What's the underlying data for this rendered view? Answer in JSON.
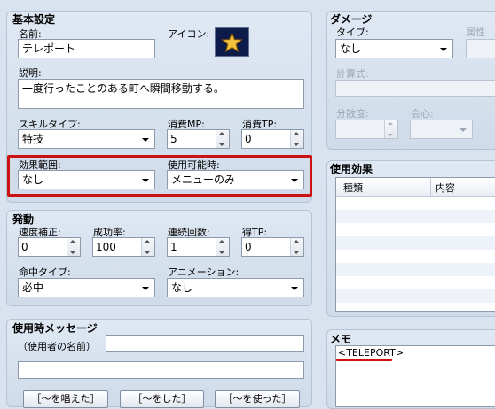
{
  "basic": {
    "title": "基本設定",
    "name_label": "名前:",
    "name_value": "テレポート",
    "icon_label": "アイコン:",
    "icon_name": "star-icon",
    "desc_label": "説明:",
    "desc_value": "一度行ったことのある町へ瞬間移動する。",
    "skilltype_label": "スキルタイプ:",
    "skilltype_value": "特技",
    "mp_label": "消費MP:",
    "mp_value": "5",
    "tp_label": "消費TP:",
    "tp_value": "0",
    "scope_label": "効果範囲:",
    "scope_value": "なし",
    "occasion_label": "使用可能時:",
    "occasion_value": "メニューのみ"
  },
  "invocation": {
    "title": "発動",
    "speed_label": "速度補正:",
    "speed_value": "0",
    "success_label": "成功率:",
    "success_value": "100",
    "repeat_label": "連続回数:",
    "repeat_value": "1",
    "tpgain_label": "得TP:",
    "tpgain_value": "0",
    "hittype_label": "命中タイプ:",
    "hittype_value": "必中",
    "animation_label": "アニメーション:",
    "animation_value": "なし"
  },
  "message": {
    "title": "使用時メッセージ",
    "user_name_label": "（使用者の名前）",
    "line1_value": "",
    "line2_value": "",
    "btn_cast": "［～を唱えた］",
    "btn_do": "［～をした］",
    "btn_use": "［～を使った］"
  },
  "damage": {
    "title": "ダメージ",
    "type_label": "タイプ:",
    "type_value": "なし",
    "element_label": "属性",
    "formula_label": "計算式:",
    "variance_label": "分散度:",
    "critical_label": "会心:"
  },
  "effects": {
    "title": "使用効果",
    "col_type": "種類",
    "col_content": "内容"
  },
  "memo": {
    "title": "メモ",
    "value": "<TELEPORT>"
  },
  "colors": {
    "highlight_red": "#cc1111",
    "panel_bg": "#d9e3ef"
  }
}
